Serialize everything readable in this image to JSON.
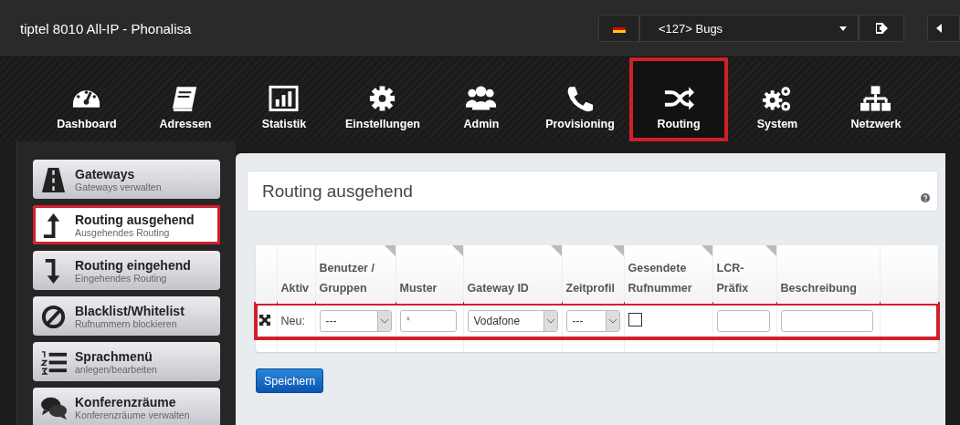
{
  "window": {
    "title": "tiptel 8010 All-IP - Phonalisa"
  },
  "header": {
    "user_select": {
      "value": "<127> Bugs"
    }
  },
  "nav": [
    {
      "label": "Dashboard",
      "kind": "dashboard",
      "selected": false,
      "highlighted": false
    },
    {
      "label": "Adressen",
      "kind": "book",
      "selected": false,
      "highlighted": false
    },
    {
      "label": "Statistik",
      "kind": "chart",
      "selected": false,
      "highlighted": false
    },
    {
      "label": "Einstellungen",
      "kind": "gear",
      "selected": false,
      "highlighted": false
    },
    {
      "label": "Admin",
      "kind": "users",
      "selected": false,
      "highlighted": false
    },
    {
      "label": "Provisioning",
      "kind": "phone",
      "selected": false,
      "highlighted": false
    },
    {
      "label": "Routing",
      "kind": "shuffle",
      "selected": true,
      "highlighted": true
    },
    {
      "label": "System",
      "kind": "gears",
      "selected": false,
      "highlighted": false
    },
    {
      "label": "Netzwerk",
      "kind": "network",
      "selected": false,
      "highlighted": false
    }
  ],
  "sidebar": {
    "items": [
      {
        "title": "Gateways",
        "subtitle": "Gateways verwalten",
        "kind": "road",
        "selected": false,
        "highlighted": false
      },
      {
        "title": "Routing ausgehend",
        "subtitle": "Ausgehendes Routing",
        "kind": "up",
        "selected": true,
        "highlighted": true
      },
      {
        "title": "Routing eingehend",
        "subtitle": "Eingehendes Routing",
        "kind": "down",
        "selected": false,
        "highlighted": false
      },
      {
        "title": "Blacklist/Whitelist",
        "subtitle": "Rufnummern blockieren",
        "kind": "ban",
        "selected": false,
        "highlighted": false
      },
      {
        "title": "Sprachmenü",
        "subtitle": "anlegen/bearbeiten",
        "kind": "list",
        "selected": false,
        "highlighted": false
      },
      {
        "title": "Konferenzräume",
        "subtitle": "Konferenzräume verwalten",
        "kind": "chat",
        "selected": false,
        "highlighted": false
      }
    ]
  },
  "page": {
    "title": "Routing ausgehend"
  },
  "table": {
    "columns": [
      {
        "label": "Aktiv",
        "corner_mark": false
      },
      {
        "label": "Benutzer / Gruppen",
        "corner_mark": true
      },
      {
        "label": "Muster",
        "corner_mark": true
      },
      {
        "label": "Gateway ID",
        "corner_mark": true
      },
      {
        "label": "Zeitprofil",
        "corner_mark": true
      },
      {
        "label": "Gesendete Rufnummer",
        "corner_mark": true
      },
      {
        "label": "LCR-Präfix",
        "corner_mark": true
      },
      {
        "label": "Beschreibung",
        "corner_mark": false
      }
    ],
    "rows": [
      {
        "highlighted": true,
        "cells": [
          {
            "kind": "label",
            "value": "Neu:"
          },
          {
            "kind": "select",
            "value": "---"
          },
          {
            "kind": "text",
            "placeholder": "*"
          },
          {
            "kind": "select",
            "value": "Vodafone"
          },
          {
            "kind": "select",
            "value": "---"
          },
          {
            "kind": "checkbox",
            "checked": false
          },
          {
            "kind": "text"
          },
          {
            "kind": "text"
          }
        ]
      }
    ]
  },
  "save_button": {
    "label": "Speichern"
  }
}
